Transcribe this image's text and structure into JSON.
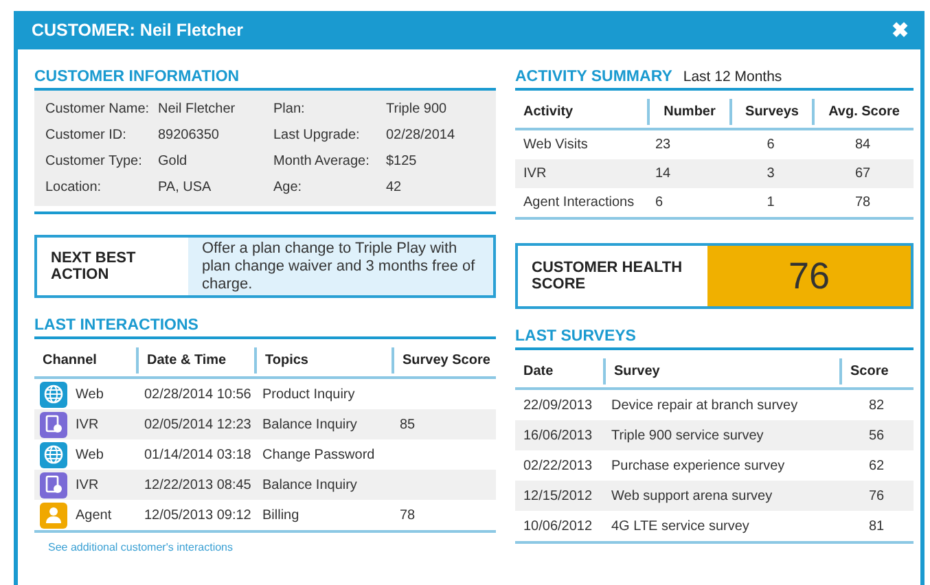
{
  "window": {
    "title": "CUSTOMER: Neil Fletcher",
    "close": "✖"
  },
  "customer_information": {
    "title": "CUSTOMER INFORMATION",
    "fields": [
      {
        "label": "Customer Name:",
        "value": "Neil Fletcher"
      },
      {
        "label": "Plan:",
        "value": "Triple 900"
      },
      {
        "label": "Customer ID:",
        "value": "89206350"
      },
      {
        "label": "Last Upgrade:",
        "value": "02/28/2014"
      },
      {
        "label": "Customer Type:",
        "value": "Gold"
      },
      {
        "label": "Month Average:",
        "value": "$125"
      },
      {
        "label": "Location:",
        "value": "PA, USA"
      },
      {
        "label": "Age:",
        "value": "42"
      }
    ]
  },
  "activity_summary": {
    "title": "ACTIVITY SUMMARY",
    "subtitle": "Last 12 Months",
    "columns": [
      "Activity",
      "Number",
      "Surveys",
      "Avg. Score"
    ],
    "rows": [
      [
        "Web Visits",
        "23",
        "6",
        "84"
      ],
      [
        "IVR",
        "14",
        "3",
        "67"
      ],
      [
        "Agent Interactions",
        "6",
        "1",
        "78"
      ]
    ]
  },
  "next_best_action": {
    "label": "NEXT BEST ACTION",
    "text": "Offer a plan change to Triple Play with plan change waiver and 3 months free of charge."
  },
  "health_score": {
    "label": "CUSTOMER HEALTH SCORE",
    "value": "76"
  },
  "last_interactions": {
    "title": "LAST INTERACTIONS",
    "columns": [
      "Channel",
      "Date & Time",
      "Topics",
      "Survey Score"
    ],
    "rows": [
      {
        "kind": "web",
        "channel": "Web",
        "date": "02/28/2014 10:56",
        "topic": "Product Inquiry"
      },
      {
        "kind": "ivr",
        "channel": "IVR",
        "date": "02/05/2014 12:23",
        "topic": "Balance Inquiry",
        "score": "85"
      },
      {
        "kind": "web",
        "channel": "Web",
        "date": "01/14/2014 03:18",
        "topic": "Change Password"
      },
      {
        "kind": "ivr",
        "channel": "IVR",
        "date": "12/22/2013 08:45",
        "topic": "Balance Inquiry"
      },
      {
        "kind": "agent",
        "channel": "Agent",
        "date": "12/05/2013 09:12",
        "topic": "Billing",
        "score": "78"
      }
    ],
    "link": "See additional customer's interactions"
  },
  "last_surveys": {
    "title": "LAST SURVEYS",
    "columns": [
      "Date",
      "Survey",
      "Score"
    ],
    "rows": [
      [
        "22/09/2013",
        "Device repair at branch survey",
        "82"
      ],
      [
        "16/06/2013",
        "Triple 900 service survey",
        "56"
      ],
      [
        "02/22/2013",
        "Purchase experience survey",
        "62"
      ],
      [
        "12/15/2012",
        "Web support arena survey",
        "76"
      ],
      [
        "10/06/2012",
        "4G LTE service survey",
        "81"
      ]
    ]
  }
}
